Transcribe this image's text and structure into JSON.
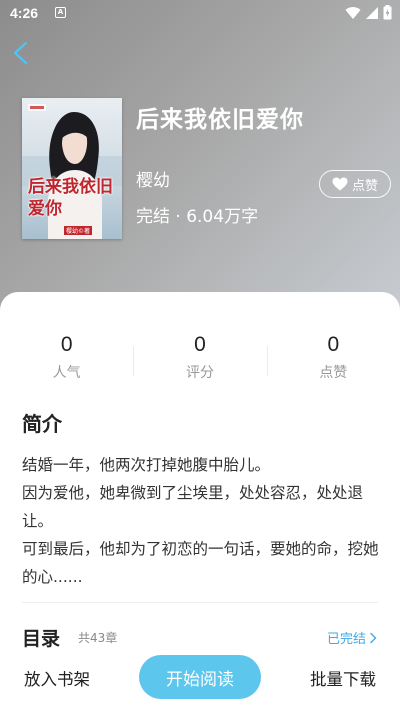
{
  "status_bar": {
    "time": "4:26",
    "notification": "A"
  },
  "book": {
    "title": "后来我依旧爱你",
    "author": "樱幼",
    "status_line": "完结 · 6.04万字",
    "cover_title": "后来我依旧爱你",
    "cover_author": "樱幼©著"
  },
  "like_button": {
    "label": "点赞"
  },
  "stats": [
    {
      "value": "0",
      "label": "人气"
    },
    {
      "value": "0",
      "label": "评分"
    },
    {
      "value": "0",
      "label": "点赞"
    }
  ],
  "intro": {
    "title": "简介",
    "lines": [
      "结婚一年，他两次打掉她腹中胎儿。",
      "因为爱他，她卑微到了尘埃里，处处容忍，处处退让。",
      "可到最后，他却为了初恋的一句话，要她的命，挖她的心......"
    ]
  },
  "toc": {
    "title": "目录",
    "count": "共43章",
    "status": "已完结"
  },
  "actions": {
    "add_shelf": "放入书架",
    "start_read": "开始阅读",
    "batch_download": "批量下载"
  },
  "colors": {
    "accent": "#5cc6ec",
    "link": "#3fa9e6",
    "back_icon": "#4fc3f7"
  }
}
